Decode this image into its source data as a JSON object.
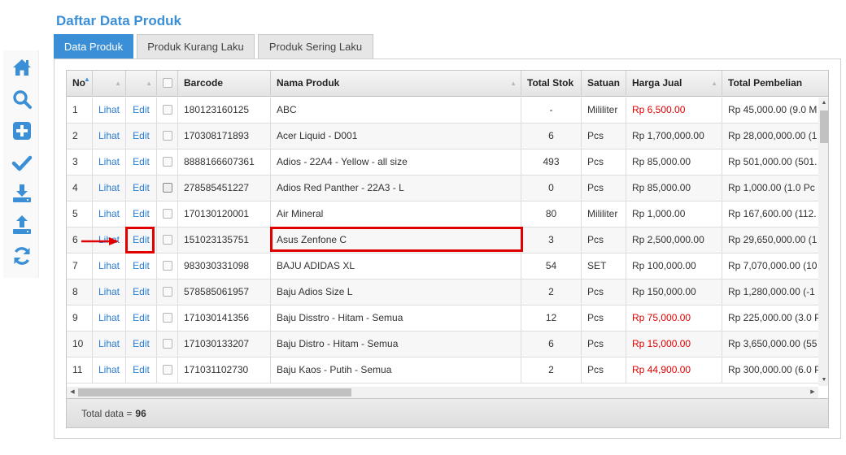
{
  "page": {
    "title": "Daftar Data Produk"
  },
  "sidebar": {
    "icons": [
      "home-icon",
      "search-icon",
      "add-icon",
      "check-icon",
      "download-icon",
      "upload-icon",
      "refresh-icon"
    ],
    "color": "#3a8fd6"
  },
  "tabs": [
    {
      "label": "Data Produk",
      "active": true
    },
    {
      "label": "Produk Kurang Laku",
      "active": false
    },
    {
      "label": "Produk Sering Laku",
      "active": false
    }
  ],
  "table": {
    "headers": {
      "no": "No",
      "barcode": "Barcode",
      "name": "Nama Produk",
      "stock": "Total Stok",
      "unit": "Satuan",
      "price": "Harga Jual",
      "purchase": "Total Pembelian"
    },
    "view_label": "Lihat",
    "edit_label": "Edit",
    "rows": [
      {
        "no": "1",
        "barcode": "180123160125",
        "name": "ABC",
        "stock": "-",
        "unit": "Mililiter",
        "price": "Rp 6,500.00",
        "price_red": true,
        "purchase": "Rp 45,000.00 (9.0 M"
      },
      {
        "no": "2",
        "barcode": "170308171893",
        "name": "Acer Liquid - D001",
        "stock": "6",
        "unit": "Pcs",
        "price": "Rp 1,700,000.00",
        "price_red": false,
        "purchase": "Rp 28,000,000.00 (1"
      },
      {
        "no": "3",
        "barcode": "8888166607361",
        "name": "Adios - 22A4 - Yellow - all size",
        "stock": "493",
        "unit": "Pcs",
        "price": "Rp 85,000.00",
        "price_red": false,
        "purchase": "Rp 501,000.00 (501."
      },
      {
        "no": "4",
        "barcode": "278585451227",
        "name": "Adios Red Panther - 22A3 - L",
        "stock": "0",
        "unit": "Pcs",
        "price": "Rp 85,000.00",
        "price_red": false,
        "purchase": "Rp 1,000.00 (1.0 Pc"
      },
      {
        "no": "5",
        "barcode": "170130120001",
        "name": "Air Mineral",
        "stock": "80",
        "unit": "Mililiter",
        "price": "Rp 1,000.00",
        "price_red": false,
        "purchase": "Rp 167,600.00 (112."
      },
      {
        "no": "6",
        "barcode": "151023135751",
        "name": "Asus Zenfone C",
        "stock": "3",
        "unit": "Pcs",
        "price": "Rp 2,500,000.00",
        "price_red": false,
        "purchase": "Rp 29,650,000.00 (1"
      },
      {
        "no": "7",
        "barcode": "983030331098",
        "name": "BAJU ADIDAS XL",
        "stock": "54",
        "unit": "SET",
        "price": "Rp 100,000.00",
        "price_red": false,
        "purchase": "Rp 7,070,000.00 (10"
      },
      {
        "no": "8",
        "barcode": "578585061957",
        "name": "Baju Adios Size L",
        "stock": "2",
        "unit": "Pcs",
        "price": "Rp 150,000.00",
        "price_red": false,
        "purchase": "Rp 1,280,000.00 (-1"
      },
      {
        "no": "9",
        "barcode": "171030141356",
        "name": "Baju Disstro - Hitam - Semua",
        "stock": "12",
        "unit": "Pcs",
        "price": "Rp 75,000.00",
        "price_red": true,
        "purchase": "Rp 225,000.00 (3.0 P"
      },
      {
        "no": "10",
        "barcode": "171030133207",
        "name": "Baju Distro - Hitam - Semua",
        "stock": "6",
        "unit": "Pcs",
        "price": "Rp 15,000.00",
        "price_red": true,
        "purchase": "Rp 3,650,000.00 (55"
      },
      {
        "no": "11",
        "barcode": "171031102730",
        "name": "Baju Kaos - Putih - Semua",
        "stock": "2",
        "unit": "Pcs",
        "price": "Rp 44,900.00",
        "price_red": true,
        "purchase": "Rp 300,000.00 (6.0 P"
      }
    ],
    "footer": {
      "label": "Total data =",
      "count": "96"
    }
  },
  "colors": {
    "accent": "#3a8fd6",
    "link": "#2a7dd4",
    "price_alert": "#dd0000",
    "annotation": "#e00000"
  }
}
